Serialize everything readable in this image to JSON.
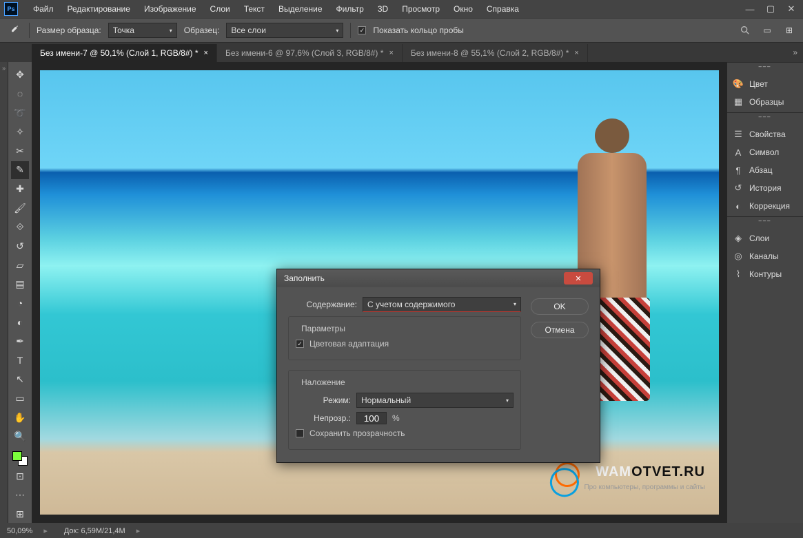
{
  "menu": [
    "Файл",
    "Редактирование",
    "Изображение",
    "Слои",
    "Текст",
    "Выделение",
    "Фильтр",
    "3D",
    "Просмотр",
    "Окно",
    "Справка"
  ],
  "options": {
    "sample_size_label": "Размер образца:",
    "sample_size_value": "Точка",
    "sample_label": "Образец:",
    "sample_value": "Все слои",
    "show_ring_label": "Показать кольцо пробы"
  },
  "tabs": [
    {
      "label": "Без имени-7 @ 50,1% (Слой 1, RGB/8#) *",
      "active": true
    },
    {
      "label": "Без имени-6 @ 97,6% (Слой 3, RGB/8#) *",
      "active": false
    },
    {
      "label": "Без имени-8 @ 55,1% (Слой 2, RGB/8#) *",
      "active": false
    }
  ],
  "right_panels": [
    {
      "group": "",
      "items": [
        {
          "icon": "palette",
          "label": "Цвет"
        },
        {
          "icon": "grid",
          "label": "Образцы"
        }
      ]
    },
    {
      "group": "",
      "items": [
        {
          "icon": "sliders",
          "label": "Свойства"
        },
        {
          "icon": "A",
          "label": "Символ"
        },
        {
          "icon": "para",
          "label": "Абзац"
        },
        {
          "icon": "history",
          "label": "История"
        },
        {
          "icon": "adjust",
          "label": "Коррекция"
        }
      ]
    },
    {
      "group": "",
      "items": [
        {
          "icon": "layers",
          "label": "Слои"
        },
        {
          "icon": "channels",
          "label": "Каналы"
        },
        {
          "icon": "paths",
          "label": "Контуры"
        }
      ]
    }
  ],
  "dialog": {
    "title": "Заполнить",
    "content_label": "Содержание:",
    "content_value": "С учетом содержимого",
    "params_legend": "Параметры",
    "color_adapt": "Цветовая адаптация",
    "blend_legend": "Наложение",
    "mode_label": "Режим:",
    "mode_value": "Нормальный",
    "opacity_label": "Непрозр.:",
    "opacity_value": "100",
    "opacity_suffix": "%",
    "preserve_trans": "Сохранить прозрачность",
    "ok": "OK",
    "cancel": "Отмена"
  },
  "status": {
    "zoom": "50,09%",
    "doc": "Док: 6,59M/21,4M"
  },
  "watermark": {
    "a": "WAM",
    "b": "OTVET.RU",
    "sub": "Про компьютеры, программы и сайты"
  }
}
